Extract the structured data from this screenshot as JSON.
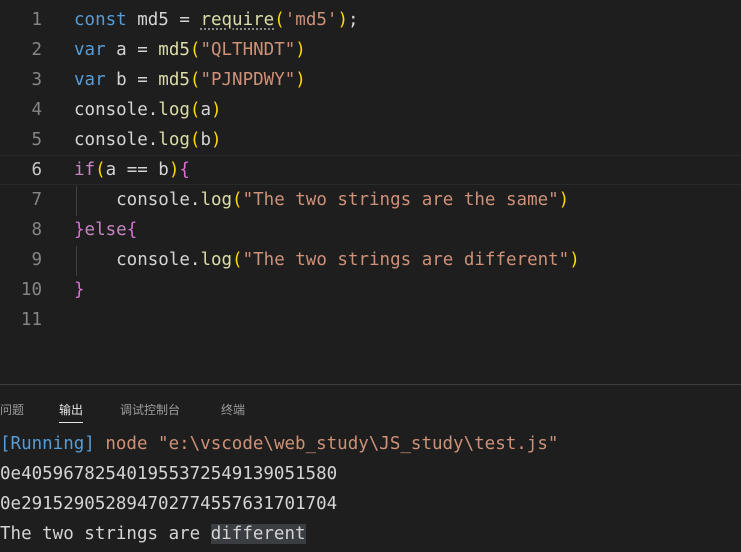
{
  "editor": {
    "lines": [
      {
        "n": "1",
        "t": [
          [
            "kw",
            "const"
          ],
          [
            "plain",
            " md5 = "
          ],
          [
            "fn squig",
            "require"
          ],
          [
            "p1",
            "("
          ],
          [
            "str",
            "'md5'"
          ],
          [
            "p1",
            ")"
          ],
          [
            "plain",
            ";"
          ]
        ]
      },
      {
        "n": "2",
        "t": [
          [
            "kw",
            "var"
          ],
          [
            "plain",
            " a = "
          ],
          [
            "fn",
            "md5"
          ],
          [
            "p1",
            "("
          ],
          [
            "str",
            "\"QLTHNDT\""
          ],
          [
            "p1",
            ")"
          ]
        ]
      },
      {
        "n": "3",
        "t": [
          [
            "kw",
            "var"
          ],
          [
            "plain",
            " b = "
          ],
          [
            "fn",
            "md5"
          ],
          [
            "p1",
            "("
          ],
          [
            "str",
            "\"PJNPDWY\""
          ],
          [
            "p1",
            ")"
          ]
        ]
      },
      {
        "n": "4",
        "t": [
          [
            "plain",
            "console."
          ],
          [
            "fn",
            "log"
          ],
          [
            "p1",
            "("
          ],
          [
            "plain",
            "a"
          ],
          [
            "p1",
            ")"
          ]
        ]
      },
      {
        "n": "5",
        "t": [
          [
            "plain",
            "console."
          ],
          [
            "fn",
            "log"
          ],
          [
            "p1",
            "("
          ],
          [
            "plain",
            "b"
          ],
          [
            "p1",
            ")"
          ]
        ]
      },
      {
        "n": "6",
        "t": [
          [
            "ctl",
            "if"
          ],
          [
            "p1",
            "("
          ],
          [
            "plain",
            "a == b"
          ],
          [
            "p1",
            ")"
          ],
          [
            "p2",
            "{"
          ]
        ]
      },
      {
        "n": "7",
        "t": [
          [
            "plain",
            "    console."
          ],
          [
            "fn",
            "log"
          ],
          [
            "p1",
            "("
          ],
          [
            "str",
            "\"The two strings are the same\""
          ],
          [
            "p1",
            ")"
          ]
        ]
      },
      {
        "n": "8",
        "t": [
          [
            "p2",
            "}"
          ],
          [
            "ctl",
            "else"
          ],
          [
            "p2",
            "{"
          ]
        ]
      },
      {
        "n": "9",
        "t": [
          [
            "plain",
            "    console."
          ],
          [
            "fn",
            "log"
          ],
          [
            "p1",
            "("
          ],
          [
            "str",
            "\"The two strings are different\""
          ],
          [
            "p1",
            ")"
          ]
        ]
      },
      {
        "n": "10",
        "t": [
          [
            "p2",
            "}"
          ]
        ]
      },
      {
        "n": "11",
        "t": []
      }
    ]
  },
  "panel": {
    "tabs": {
      "problems": "问题",
      "output": "输出",
      "debug_console": "调试控制台",
      "terminal": "终端"
    },
    "output": {
      "running_tag": "[Running]",
      "running_cmd": " node \"e:\\vscode\\web_study\\JS_study\\test.js\"",
      "hash_a": "0e405967825401955372549139051580",
      "hash_b": "0e291529052894702774557631701704",
      "result_prefix": "The two strings are ",
      "result_highlight": "different"
    }
  }
}
